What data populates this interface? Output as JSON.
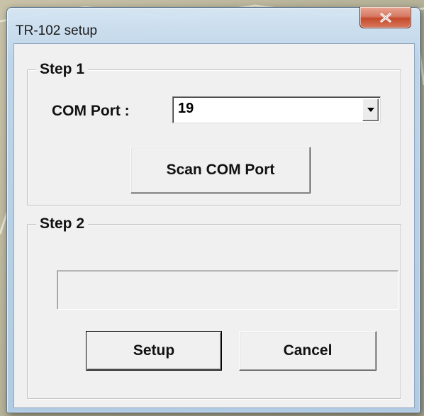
{
  "window": {
    "title": "TR-102 setup"
  },
  "step1": {
    "legend": "Step 1",
    "com_port_label": "COM Port :",
    "com_port_value": "19",
    "scan_button": "Scan COM Port"
  },
  "step2": {
    "legend": "Step 2",
    "progress": 0,
    "setup_button": "Setup",
    "cancel_button": "Cancel"
  },
  "colors": {
    "close_button": "#c44a2c",
    "dialog_background": "#f0f0f0",
    "titlebar": "#bed6ec"
  },
  "icons": {
    "close": "close-icon",
    "dropdown": "chevron-down-icon"
  }
}
